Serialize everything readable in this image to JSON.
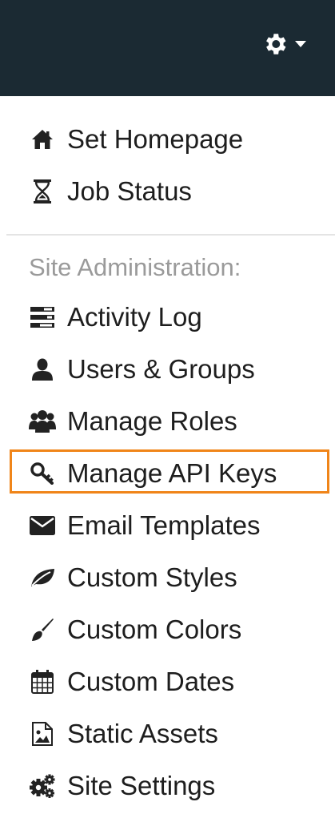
{
  "header": {
    "settings_icon": "gear-icon",
    "caret_icon": "caret-down-icon",
    "background": "#1b2a33"
  },
  "menu": {
    "top_items": [
      {
        "label": "Set Homepage",
        "icon": "home-icon"
      },
      {
        "label": "Job Status",
        "icon": "hourglass-icon"
      }
    ],
    "section_header": "Site Administration:",
    "admin_items": [
      {
        "label": "Activity Log",
        "icon": "tasks-icon"
      },
      {
        "label": "Users & Groups",
        "icon": "user-icon"
      },
      {
        "label": "Manage Roles",
        "icon": "users-icon"
      },
      {
        "label": "Manage API Keys",
        "icon": "key-icon",
        "highlighted": true
      },
      {
        "label": "Email Templates",
        "icon": "envelope-icon"
      },
      {
        "label": "Custom Styles",
        "icon": "leaf-icon"
      },
      {
        "label": "Custom Colors",
        "icon": "paint-brush-icon"
      },
      {
        "label": "Custom Dates",
        "icon": "calendar-icon"
      },
      {
        "label": "Static Assets",
        "icon": "image-file-icon"
      },
      {
        "label": "Site Settings",
        "icon": "cogs-icon"
      }
    ]
  },
  "highlight_color": "#f08519"
}
